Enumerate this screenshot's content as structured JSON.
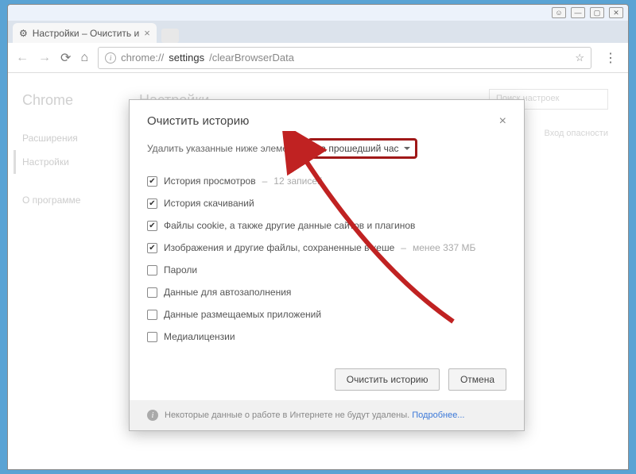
{
  "tab": {
    "title": "Настройки – Очистить и",
    "icon": "gear-icon"
  },
  "url": {
    "scheme": "chrome://",
    "dark": "settings",
    "rest": "/clearBrowserData"
  },
  "sidebar": {
    "title": "Chrome",
    "items": [
      "Расширения",
      "Настройки",
      "О программе"
    ],
    "active_index": 1
  },
  "main": {
    "title": "Настройки",
    "search_placeholder": "Поиск настроек",
    "section": "Вход                  опасности"
  },
  "dialog": {
    "title": "Очистить историю",
    "prompt": "Удалить указанные ниже элементы",
    "select_value": "за прошедший час",
    "items": [
      {
        "label": "История просмотров",
        "suffix": "12 записей",
        "checked": true
      },
      {
        "label": "История скачиваний",
        "checked": true
      },
      {
        "label": "Файлы cookie, а также другие данные сайтов и плагинов",
        "checked": true
      },
      {
        "label": "Изображения и другие файлы, сохраненные в кеше",
        "suffix": "менее 337 МБ",
        "checked": true
      },
      {
        "label": "Пароли",
        "checked": false
      },
      {
        "label": "Данные для автозаполнения",
        "checked": false
      },
      {
        "label": "Данные размещаемых приложений",
        "checked": false
      },
      {
        "label": "Медиалицензии",
        "checked": false
      }
    ],
    "clear_btn": "Очистить историю",
    "cancel_btn": "Отмена",
    "footer_text": "Некоторые данные о работе в Интернете не будут удалены.",
    "footer_link": "Подробнее..."
  },
  "annotation": {
    "arrow_color": "#c02222"
  }
}
